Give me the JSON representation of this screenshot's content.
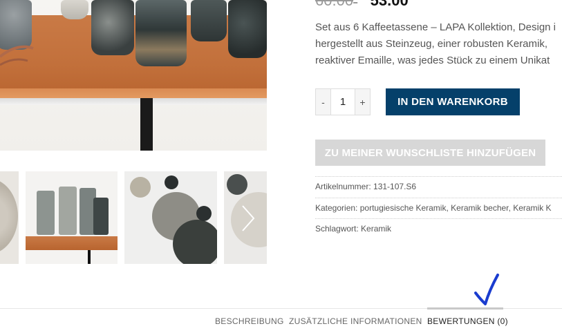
{
  "product": {
    "old_price": "60.00",
    "new_price": "53.00",
    "currency": "€",
    "description_lines": [
      "Set aus 6 Kaffeetassene – LAPA Kollektion, Design i",
      "hergestellt aus Steinzeug, einer robusten Keramik,",
      "reaktiver Emaille, was jedes Stück zu einem Unikat"
    ]
  },
  "quantity": {
    "minus_label": "-",
    "value": "1",
    "plus_label": "+"
  },
  "buttons": {
    "add_to_cart": "IN DEN WARENKORB",
    "wishlist": "ZU MEINER WUNSCHLISTE HINZUFÜGEN"
  },
  "meta": {
    "sku_label": "Artikelnummer:",
    "sku_value": "131-107.S6",
    "categories_label": "Kategorien:",
    "categories": [
      "portugiesische Keramik",
      "Keramik becher",
      "Keramik K"
    ],
    "tag_label": "Schlagwort:",
    "tag_value": "Keramik"
  },
  "tabs": [
    {
      "label": "BESCHREIBUNG",
      "active": false
    },
    {
      "label": "ZUSÄTZLICHE INFORMATIONEN",
      "active": false
    },
    {
      "label": "BEWERTUNGEN (0)",
      "active": true
    }
  ],
  "icons": {
    "carousel_next": "chevron-right-icon",
    "annotation": "checkmark-icon"
  },
  "colors": {
    "primary_button": "#05406a",
    "wishlist_button": "#d7d7d7",
    "annotation_check": "#1a3ccf"
  }
}
